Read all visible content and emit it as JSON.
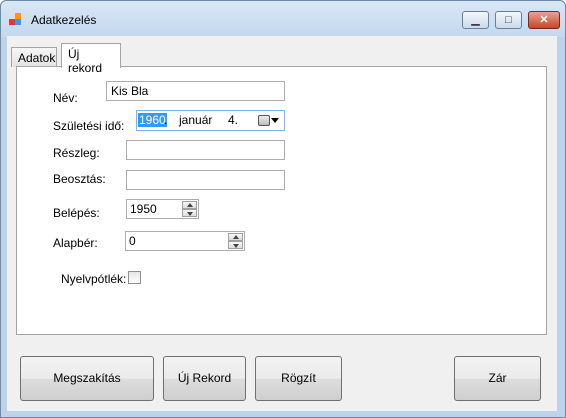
{
  "window": {
    "title": "Adatkezelés",
    "controls": {
      "minimize": "▁",
      "maximize": "□",
      "close": "✕"
    }
  },
  "tabs": [
    {
      "label": "Adatok",
      "active": false
    },
    {
      "label": "Új rekord",
      "active": true
    }
  ],
  "form": {
    "name": {
      "label": "Név:",
      "value": "Kis Bla"
    },
    "birth_date": {
      "label": "Születési idő:",
      "year": "1960",
      "month": "január",
      "day": "4."
    },
    "department": {
      "label": "Részleg:",
      "value": ""
    },
    "position": {
      "label": "Beosztás:",
      "value": ""
    },
    "hire_year": {
      "label": "Belépés:",
      "value": "1950"
    },
    "base_salary": {
      "label": "Alapbér:",
      "value": "0"
    },
    "language_bonus": {
      "label": "Nyelvpótlék:",
      "checked": false
    }
  },
  "buttons": {
    "cancel": "Megszakítás",
    "new_record": "Új Rekord",
    "save": "Rögzít",
    "close": "Zár"
  },
  "icons": [
    "app-icon",
    "calendar-icon",
    "dropdown-arrow-icon",
    "spin-up-icon",
    "spin-down-icon"
  ]
}
